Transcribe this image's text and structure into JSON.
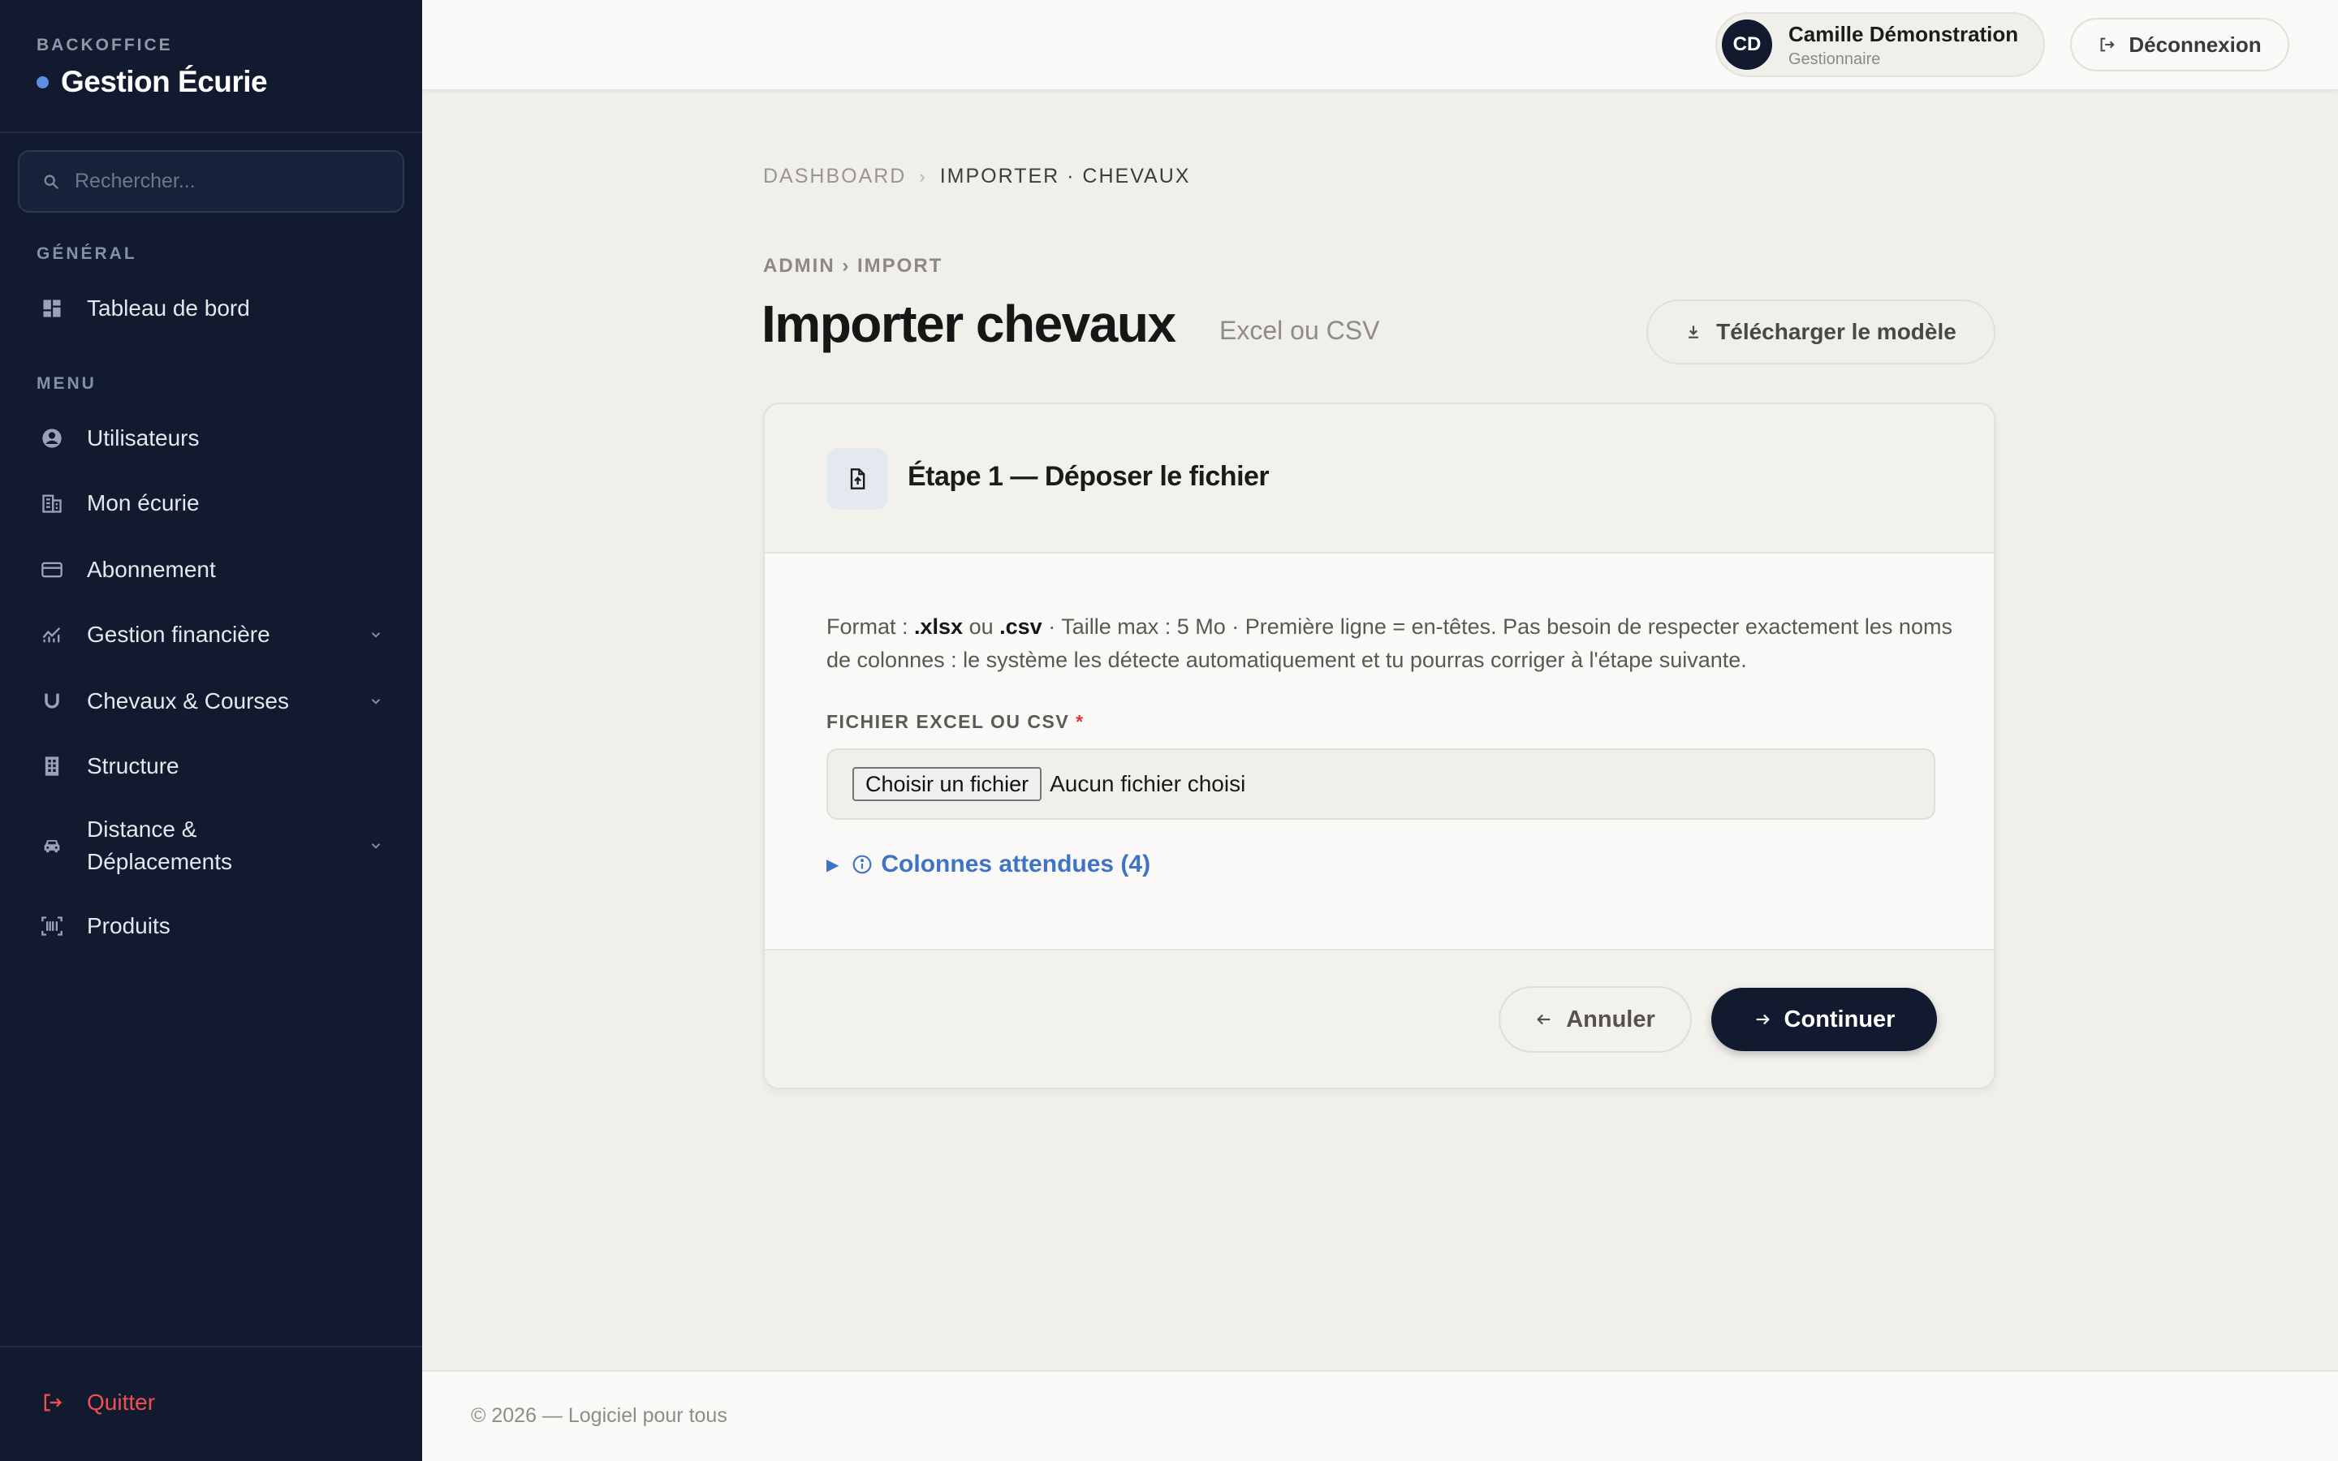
{
  "sidebar": {
    "kicker": "BACKOFFICE",
    "title": "Gestion Écurie",
    "search_placeholder": "Rechercher...",
    "section_general": "GÉNÉRAL",
    "section_menu": "MENU",
    "items": [
      {
        "label": "Tableau de bord",
        "icon": "dashboard-icon"
      },
      {
        "label": "Utilisateurs",
        "icon": "user-circle-icon"
      },
      {
        "label": "Mon écurie",
        "icon": "building-icon"
      },
      {
        "label": "Abonnement",
        "icon": "credit-card-icon"
      },
      {
        "label": "Gestion financière",
        "icon": "finance-chart-icon",
        "expandable": true
      },
      {
        "label": "Chevaux & Courses",
        "icon": "horseshoe-icon",
        "expandable": true
      },
      {
        "label": "Structure",
        "icon": "grid-building-icon"
      },
      {
        "label": "Distance & Déplacements",
        "icon": "car-icon",
        "expandable": true
      },
      {
        "label": "Produits",
        "icon": "barcode-scan-icon"
      }
    ],
    "quit_label": "Quitter"
  },
  "topbar": {
    "user_initials": "CD",
    "user_name": "Camille Démonstration",
    "user_role": "Gestionnaire",
    "logout_label": "Déconnexion"
  },
  "breadcrumb": {
    "root": "DASHBOARD",
    "current": "IMPORTER · CHEVAUX"
  },
  "page": {
    "kicker": "ADMIN › IMPORT",
    "title": "Importer chevaux",
    "subtitle": "Excel ou CSV",
    "download_label": "Télécharger le modèle"
  },
  "card": {
    "step_title": "Étape 1 — Déposer le fichier",
    "desc_prefix": "Format : ",
    "desc_xlsx": ".xlsx",
    "desc_or": " ou ",
    "desc_csv": ".csv",
    "desc_rest": " · Taille max : 5 Mo · Première ligne = en-têtes. Pas besoin de respecter exactement les noms de colonnes : le système les détecte automatiquement et tu pourras corriger à l'étape suivante.",
    "field_label": "FICHIER EXCEL OU CSV",
    "required_mark": "*",
    "file_button": "Choisir un fichier",
    "file_status": "Aucun fichier choisi",
    "expected_columns": "Colonnes attendues (4)",
    "cancel_label": "Annuler",
    "continue_label": "Continuer"
  },
  "footer": {
    "text": "© 2026 — Logiciel pour tous"
  },
  "colors": {
    "sidebar_bg": "#111a2e",
    "accent_blue": "#3f74c4",
    "danger": "#ef4f4f",
    "page_bg": "#f1efea"
  }
}
